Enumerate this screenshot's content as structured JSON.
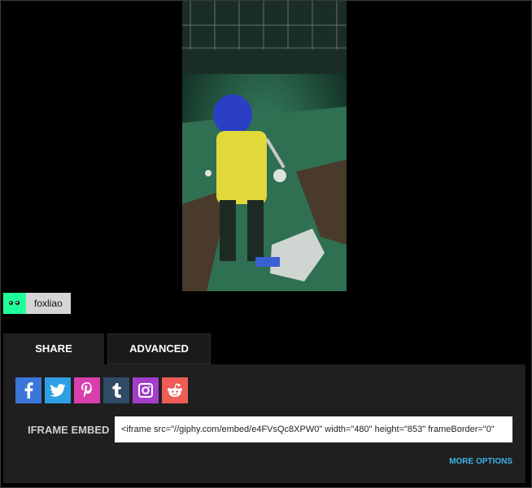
{
  "user": {
    "name": "foxliao"
  },
  "tabs": [
    {
      "label": "SHARE",
      "active": true
    },
    {
      "label": "ADVANCED",
      "active": false
    }
  ],
  "share": {
    "social_icons": [
      "facebook-icon",
      "twitter-icon",
      "pinterest-icon",
      "tumblr-icon",
      "instagram-icon",
      "reddit-icon"
    ],
    "social_colors": {
      "facebook": "#3b76d8",
      "twitter": "#2f9fe4",
      "pinterest": "#d83fad",
      "tumblr": "#2f4b66",
      "instagram": "#a23ec7",
      "reddit": "#ef5b55"
    },
    "embed_label": "IFRAME EMBED",
    "embed_code": "<iframe src=\"//giphy.com/embed/e4FVsQc8XPW0\" width=\"480\" height=\"853\" frameBorder=\"0\"",
    "more_options": "MORE OPTIONS"
  },
  "colors": {
    "avatar": "#1fff9a",
    "link": "#3fb3ea"
  }
}
